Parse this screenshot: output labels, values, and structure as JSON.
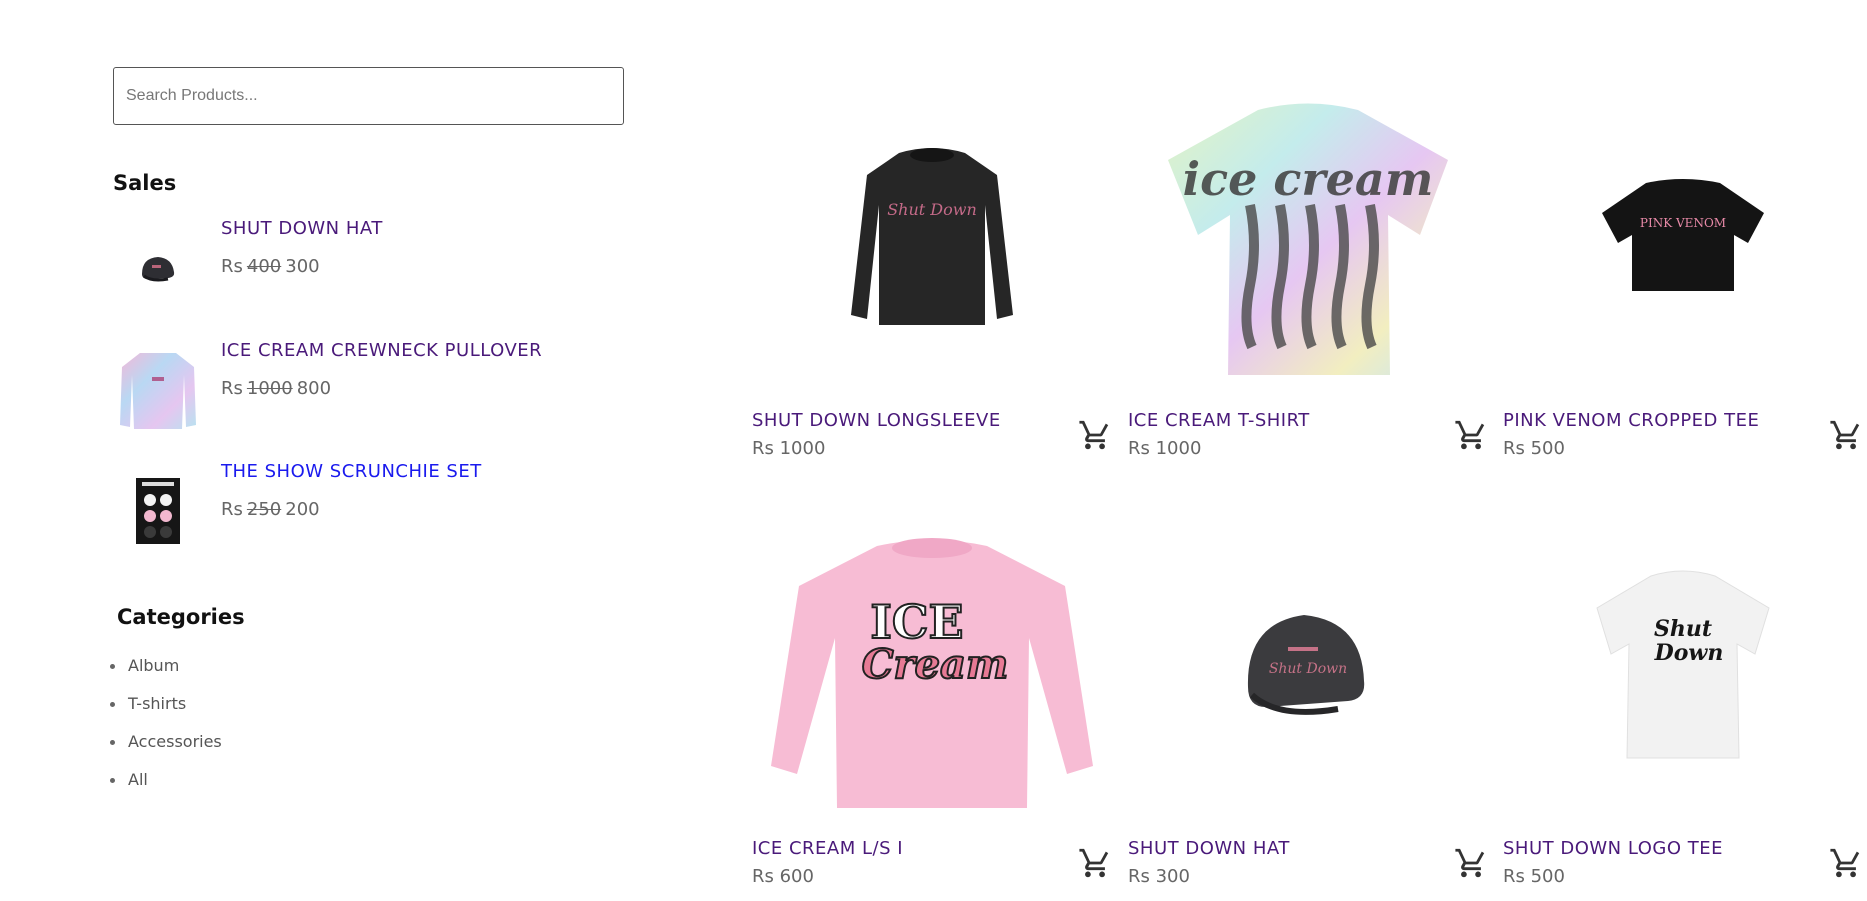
{
  "search": {
    "placeholder": "Search Products..."
  },
  "sales": {
    "title": "Sales",
    "items": [
      {
        "name": "SHUT DOWN HAT",
        "currency": "Rs",
        "old_price": "400",
        "new_price": "300"
      },
      {
        "name": "ICE CREAM CREWNECK PULLOVER",
        "currency": "Rs",
        "old_price": "1000",
        "new_price": "800"
      },
      {
        "name": "THE SHOW SCRUNCHIE SET",
        "currency": "Rs",
        "old_price": "250",
        "new_price": "200"
      }
    ]
  },
  "categories": {
    "title": "Categories",
    "items": [
      "Album",
      "T-shirts",
      "Accessories",
      "All"
    ]
  },
  "products": [
    {
      "name": "SHUT DOWN LONGSLEEVE",
      "price": "Rs 1000"
    },
    {
      "name": "ICE CREAM T-SHIRT",
      "price": "Rs 1000"
    },
    {
      "name": "PINK VENOM CROPPED TEE",
      "price": "Rs 500"
    },
    {
      "name": "ICE CREAM L/S I",
      "price": "Rs 600"
    },
    {
      "name": "SHUT DOWN HAT",
      "price": "Rs 300"
    },
    {
      "name": "SHUT DOWN LOGO TEE",
      "price": "Rs 500"
    }
  ],
  "icons": {
    "cart": "shopping-cart-icon"
  },
  "colors": {
    "product_name": "#4a1a7a",
    "active_link": "#1a1aee",
    "price": "#666666"
  }
}
